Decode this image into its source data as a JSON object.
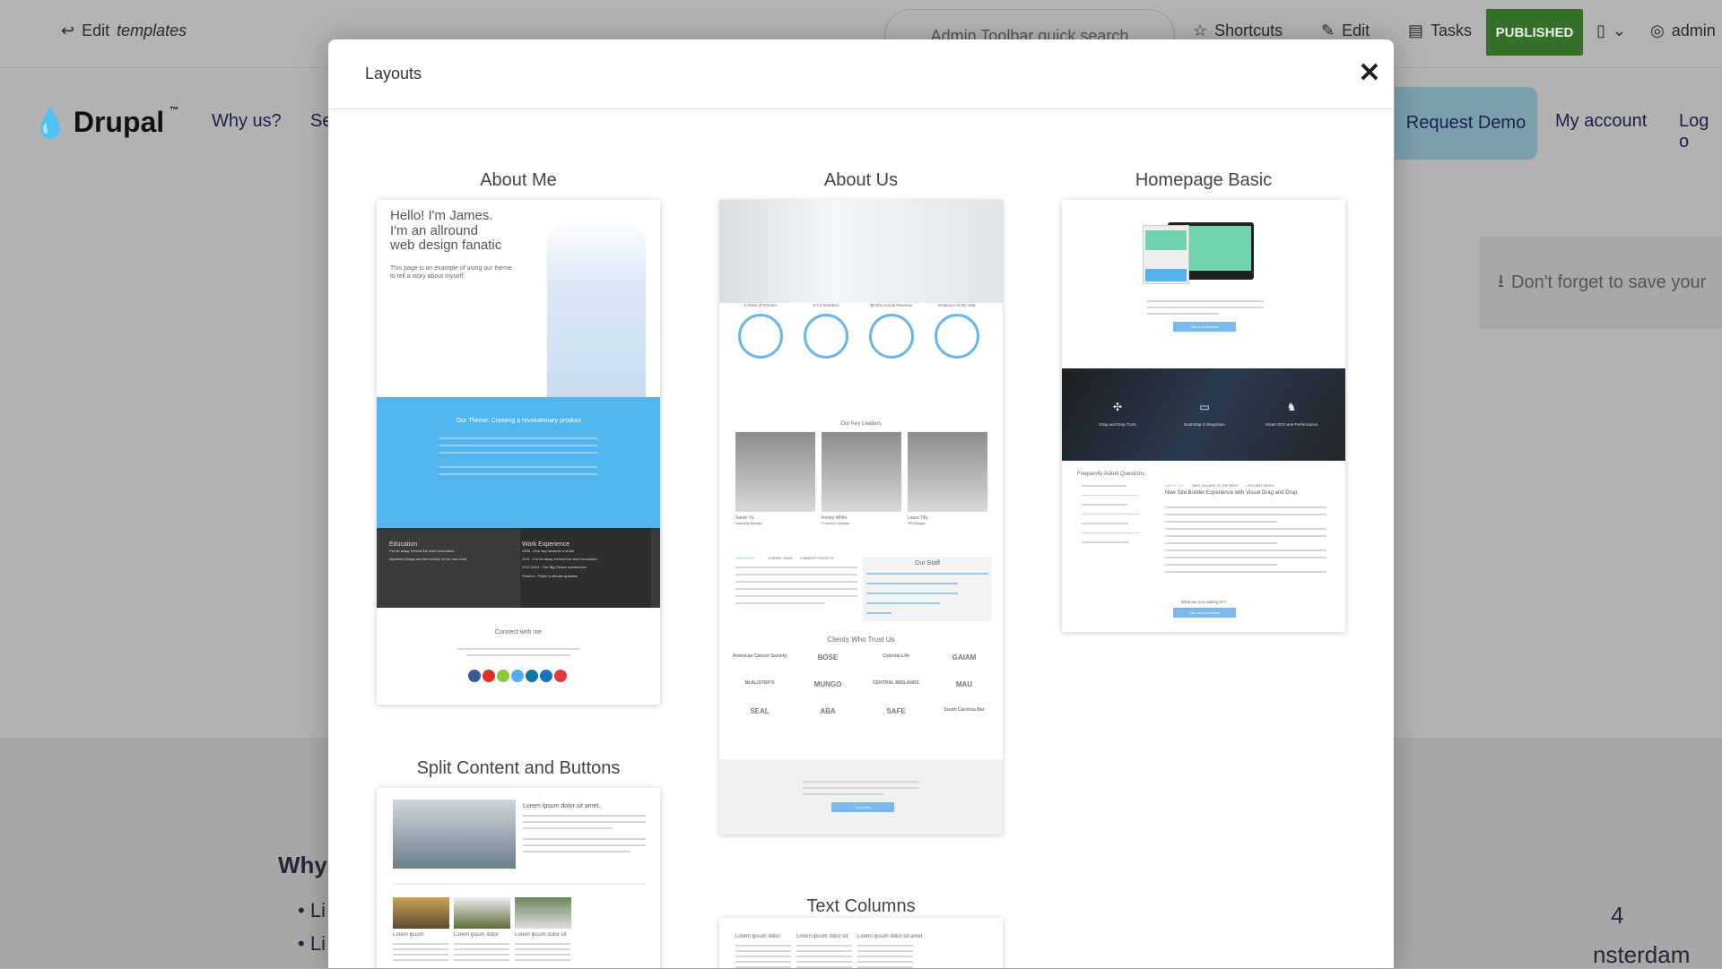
{
  "toolbar": {
    "back_label": "Edit",
    "back_label_em": "templates",
    "search_placeholder": "Admin Toolbar quick search",
    "shortcuts": "Shortcuts",
    "edit": "Edit",
    "tasks": "Tasks",
    "published": "PUBLISHED",
    "user": "admin",
    "accent": "#35702b"
  },
  "site": {
    "logo": "Drupal",
    "nav": [
      "Why us?",
      "Se"
    ],
    "right_nav": {
      "request_demo": "Request Demo",
      "my_account": "My account",
      "logout": "Log o"
    },
    "save_notice": "Don't forget to save your",
    "why": "Why",
    "bullets": [
      "Li",
      "Li"
    ],
    "right_text": [
      "4",
      "nsterdam"
    ]
  },
  "modal": {
    "title": "Layouts",
    "close_icon": "close-icon",
    "layouts": [
      {
        "title": "About Me",
        "hero": [
          "Hello! I'm James.",
          "I'm an allround",
          "web design fanatic"
        ],
        "sub": "This page is an example of using our theme to tell a story about myself.",
        "band_title": "Our Theme: Creating a revolutionary product",
        "education": "Education",
        "edu_items": [
          "Far far away, behind the word mountains",
          "Alphabet Village and the subline of her own road"
        ],
        "work": "Work Experience",
        "work_items": [
          "2008 - One day however a small",
          "2011 - Far far away, behind the word mountains",
          "2012-2013 - The Big Oxmox advised her",
          "Present - Pityful a rethoric question"
        ],
        "connect": "Connect with me",
        "social_colors": [
          "#3b5998",
          "#e52d27",
          "#8dc63f",
          "#55acee",
          "#0e76a8",
          "#1a73c1",
          "#e0393e"
        ]
      },
      {
        "title": "About Us",
        "stats": [
          "9 Years of Practice",
          "5 Co-founders",
          "$8.5m Annual Revenue",
          "Employer of the Year"
        ],
        "leaders_title": "Our Key Leaders",
        "leaders": [
          {
            "name": "Sarah Yu",
            "role": "Marketing Manager"
          },
          {
            "name": "Kenny White",
            "role": "Production Manager"
          },
          {
            "name": "Laura Tilly",
            "role": "HR Manager"
          }
        ],
        "tabs": [
          "OUR MISSION",
          "COMPANY VISION",
          "COMMUNITY PROJECTS"
        ],
        "staff_title": "Our Staff",
        "clients_title": "Clients Who Trust Us",
        "clients": [
          "American Cancer Society",
          "BOSE",
          "Colonial Life",
          "GAIAM",
          "McALISTER'S",
          "MUNGO",
          "CENTRAL MIDLANDS",
          "MAU",
          "SEAL",
          "ABA",
          "SAFE",
          "South Carolina Bar"
        ],
        "cta": "Try it now"
      },
      {
        "title": "Homepage Basic",
        "download": "Join to Download",
        "features": [
          "Drag and Drop Tools",
          "Bootstrap 3 Integration",
          "Smart SEO and Performance"
        ],
        "faq_title": "Frequently Asked Questions",
        "tabs": [
          "ABOUT US",
          "WHY GLAZED IS THE BEST",
          "RECENT NEWS"
        ],
        "headline": "New Site Builder Experience with Visual Drag and Drop",
        "waiting": "What are you waiting for?",
        "cta": "Join and Download"
      },
      {
        "title": "Split Content and Buttons",
        "heading": "Lorem ipsum dolor sit amet.",
        "cols": [
          "Lorem ipsum",
          "Lorem ipsum dolor",
          "Lorem ipsum dolor sit"
        ]
      },
      {
        "title": "Text Columns",
        "cols": [
          "Lorem ipsum dolor",
          "Lorem ipsum dolor sit",
          "Lorem ipsum dolor sit amet"
        ]
      }
    ]
  }
}
